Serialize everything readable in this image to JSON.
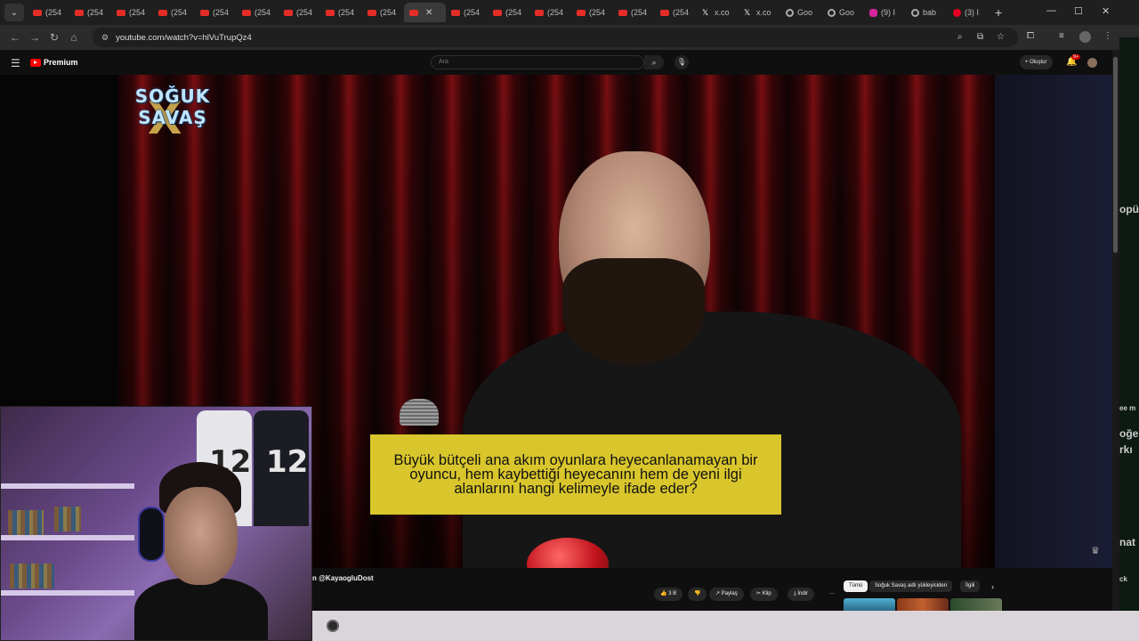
{
  "browser": {
    "tabs": [
      {
        "icon": "youtube",
        "label": "(254"
      },
      {
        "icon": "youtube",
        "label": "(254"
      },
      {
        "icon": "youtube",
        "label": "(254"
      },
      {
        "icon": "youtube",
        "label": "(254"
      },
      {
        "icon": "youtube",
        "label": "(254"
      },
      {
        "icon": "youtube",
        "label": "(254"
      },
      {
        "icon": "youtube",
        "label": "(254"
      },
      {
        "icon": "youtube",
        "label": "(254"
      },
      {
        "icon": "youtube",
        "label": "(254"
      },
      {
        "icon": "youtube",
        "label": "",
        "active": true
      },
      {
        "icon": "youtube",
        "label": "(254"
      },
      {
        "icon": "youtube",
        "label": "(254"
      },
      {
        "icon": "youtube",
        "label": "(254"
      },
      {
        "icon": "youtube",
        "label": "(254"
      },
      {
        "icon": "youtube",
        "label": "(254"
      },
      {
        "icon": "youtube",
        "label": "(254"
      },
      {
        "icon": "x",
        "label": "x.co"
      },
      {
        "icon": "x",
        "label": "x.co"
      },
      {
        "icon": "google",
        "label": "Goo"
      },
      {
        "icon": "google",
        "label": "Goo"
      },
      {
        "icon": "instagram",
        "label": "(9) I"
      },
      {
        "icon": "google",
        "label": "bab"
      },
      {
        "icon": "pinterest",
        "label": "(3) I"
      }
    ],
    "url": "youtube.com/watch?v=hlVuTrupQz4",
    "new_tab_symbol": "+",
    "tab_close_symbol": "✕"
  },
  "youtube": {
    "brand": "Premium",
    "search_placeholder": "Ara",
    "create_label": "+ Oluştur",
    "notification_count": "9+",
    "video": {
      "show_logo_line1": "SOĞUK",
      "show_logo_line2": "SAVAŞ",
      "show_logo_mark": "X",
      "caption": "Büyük bütçeli ana akım oyunlara heyecanlanamayan bir oyuncu, hem kaybettiği heyecanını hem de yeni ilgi alanlarını hangi kelimeyle ifade eder?"
    },
    "channel_text": "n @KayaogluDost",
    "actions": {
      "like": "👍 3 B",
      "dislike": "👎",
      "share": "↗ Paylaş",
      "clip": "✂ Klip",
      "download": "⤓ İndir",
      "more": "···"
    },
    "chips": [
      "Tümü",
      "Soğuk Savaş adlı yükleyiciden",
      "İlgili"
    ]
  },
  "side_app_text": [
    "opü",
    "ee m",
    "oğe",
    "rkı",
    "nat",
    "ck"
  ],
  "colors": {
    "caption_bg": "#d9c62c",
    "yt_red": "#ff0000"
  }
}
